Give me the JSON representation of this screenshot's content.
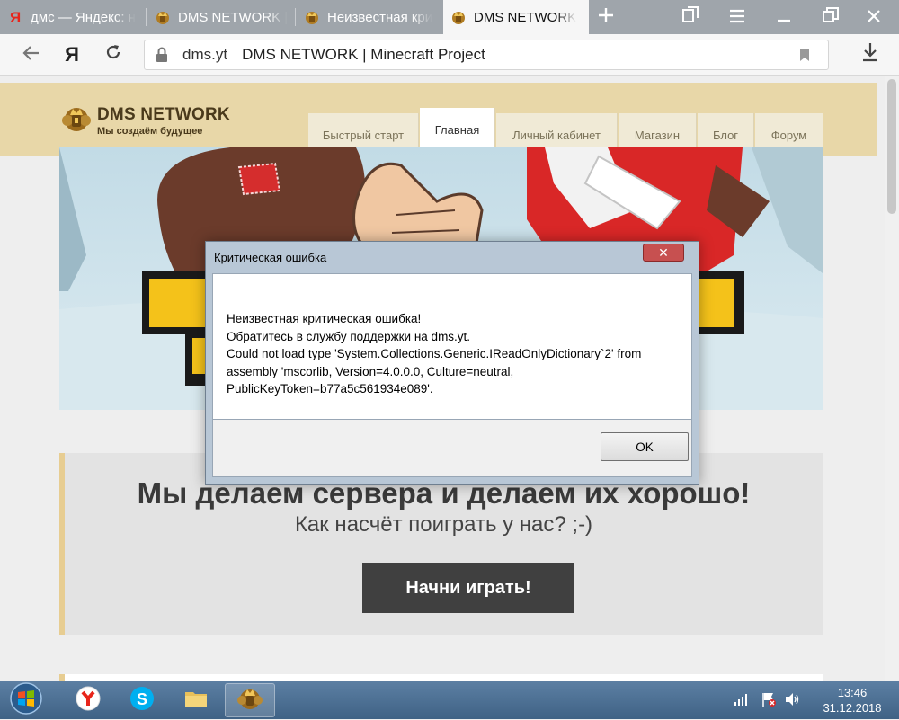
{
  "browser": {
    "tabs": [
      {
        "title": "дмс — Яндекс: н",
        "icon": "yandex-icon",
        "active": false
      },
      {
        "title": "DMS NETWORK |",
        "icon": "dms-crown-icon",
        "active": false
      },
      {
        "title": "Неизвестная кри",
        "icon": "dms-crown-icon",
        "active": false
      },
      {
        "title": "DMS NETWORK",
        "icon": "dms-crown-icon",
        "active": true
      }
    ],
    "address": {
      "host": "dms.yt",
      "page_title": "DMS NETWORK | Minecraft Project"
    },
    "yandex_button": "Я"
  },
  "site": {
    "logo": {
      "brand": "DMS NETWORK",
      "tagline": "Мы создаём будущее"
    },
    "nav": [
      {
        "label": "Быстрый старт",
        "active": false
      },
      {
        "label": "Главная",
        "active": true
      },
      {
        "label": "Личный кабинет",
        "active": false
      },
      {
        "label": "Магазин",
        "active": false
      },
      {
        "label": "Блог",
        "active": false
      },
      {
        "label": "Форум",
        "active": false
      }
    ],
    "cta": {
      "title": "Мы делаем сервера и делаем их хорошо!",
      "subtitle": "Как насчёт поиграть у нас? ;-)",
      "button": "Начни играть!"
    }
  },
  "dialog": {
    "title": "Критическая ошибка",
    "lines": [
      "Неизвестная критическая ошибка!",
      "Обратитесь в службу поддержки на dms.yt.",
      "Could not load type 'System.Collections.Generic.IReadOnlyDictionary`2' from",
      "assembly 'mscorlib, Version=4.0.0.0, Culture=neutral,",
      "PublicKeyToken=b77a5c561934e089'."
    ],
    "ok": "OK",
    "close": "✕"
  },
  "taskbar": {
    "time": "13:46",
    "date": "31.12.2018",
    "items": [
      "yandex-browser-icon",
      "skype-icon",
      "folder-icon",
      "dms-launcher-icon"
    ]
  },
  "colors": {
    "tab_strip": "#9fa5ab",
    "site_header": "#e8d7a8",
    "cta_button": "#404040",
    "dialog_close": "#c75050"
  }
}
